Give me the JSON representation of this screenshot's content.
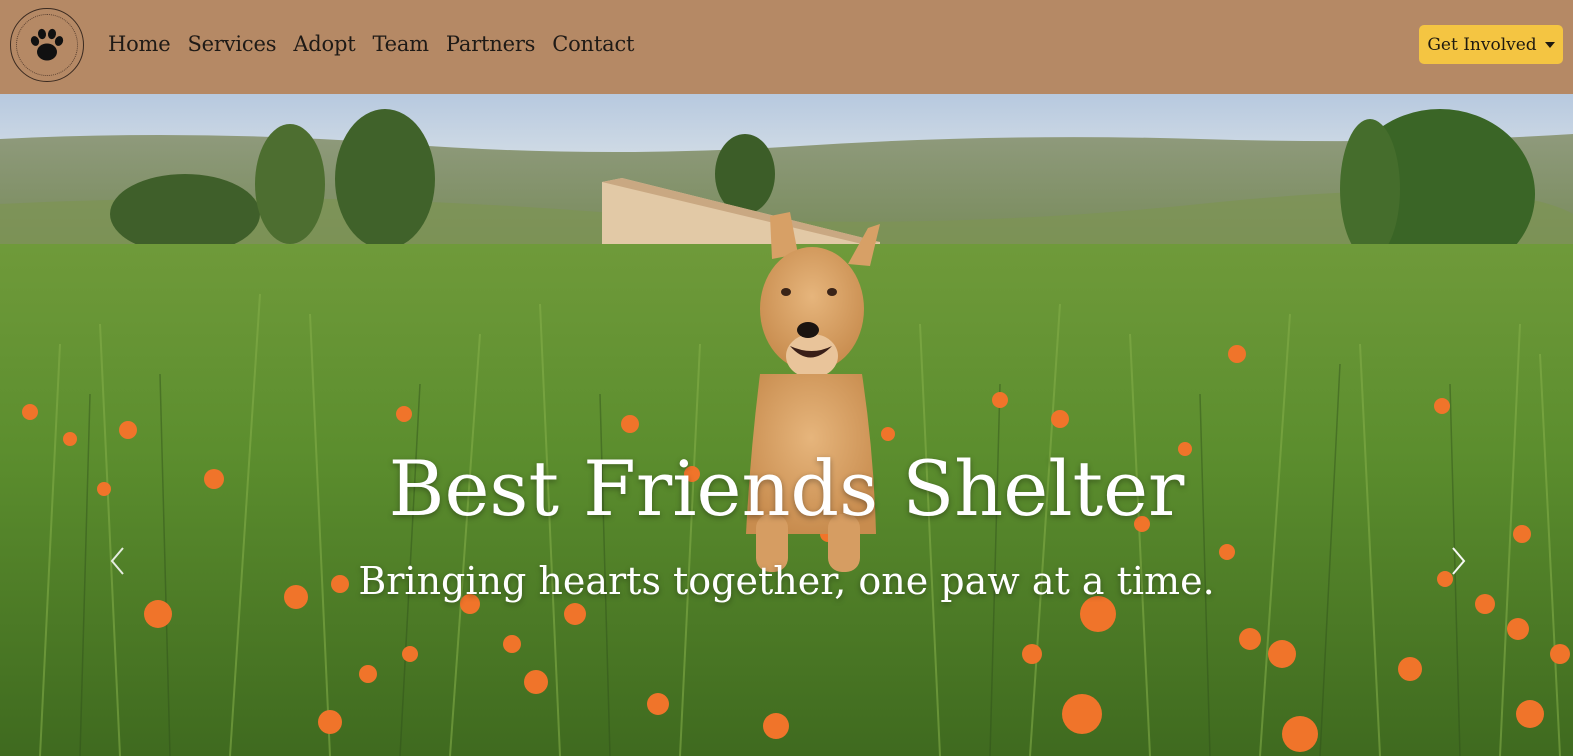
{
  "brand": {
    "logo_icon": "paw-print-icon",
    "logo_ring_text": "BEST FRIENDS SHELTER"
  },
  "nav": {
    "items": [
      {
        "label": "Home"
      },
      {
        "label": "Services"
      },
      {
        "label": "Adopt"
      },
      {
        "label": "Team"
      },
      {
        "label": "Partners"
      },
      {
        "label": "Contact"
      }
    ],
    "cta_label": "Get Involved",
    "cta_icon": "caret-down-icon"
  },
  "hero": {
    "title": "Best Friends Shelter",
    "subtitle": "Bringing hearts together, one paw at a time.",
    "prev_icon": "chevron-left-icon",
    "next_icon": "chevron-right-icon"
  },
  "colors": {
    "navbar_bg": "#b58965",
    "cta_bg": "#f4c542",
    "nav_text": "#1f1a16",
    "caption_text": "#ffffff"
  }
}
